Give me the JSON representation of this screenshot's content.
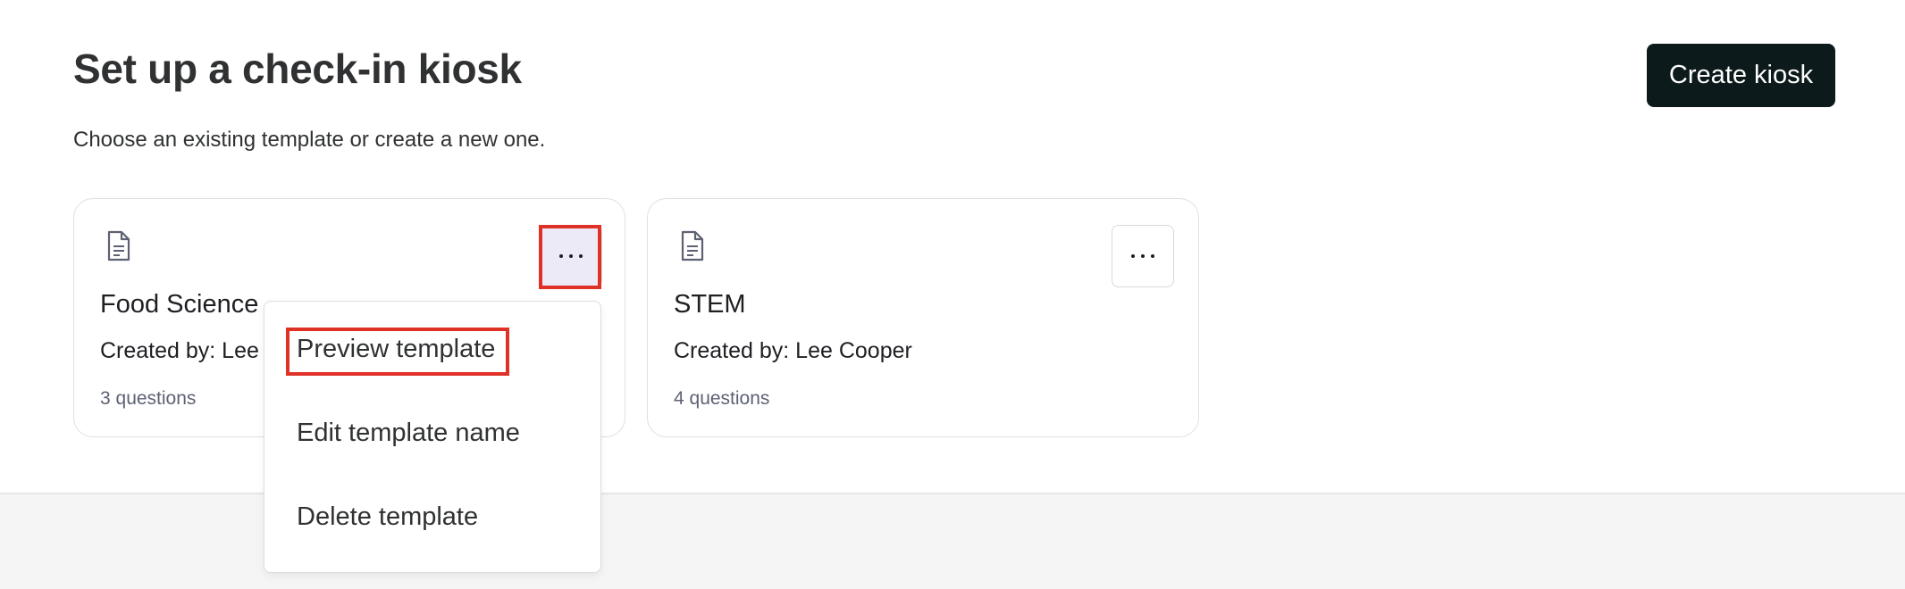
{
  "header": {
    "title": "Set up a check-in kiosk",
    "subtitle": "Choose an existing template or create a new one.",
    "create_button_label": "Create kiosk"
  },
  "templates": [
    {
      "title": "Food Science",
      "created_by": "Created by: Lee",
      "question_count": "3 questions",
      "icon": "document-icon",
      "menu_open": true
    },
    {
      "title": "STEM",
      "created_by": "Created by: Lee Cooper",
      "question_count": "4 questions",
      "icon": "document-icon",
      "menu_open": false
    }
  ],
  "dropdown_menu": {
    "items": [
      {
        "label": "Preview template"
      },
      {
        "label": "Edit template name"
      },
      {
        "label": "Delete template"
      }
    ]
  },
  "colors": {
    "primary_button": "#0d1a1b",
    "highlight": "#e03127",
    "open_menu_button": "#eceaf6"
  }
}
